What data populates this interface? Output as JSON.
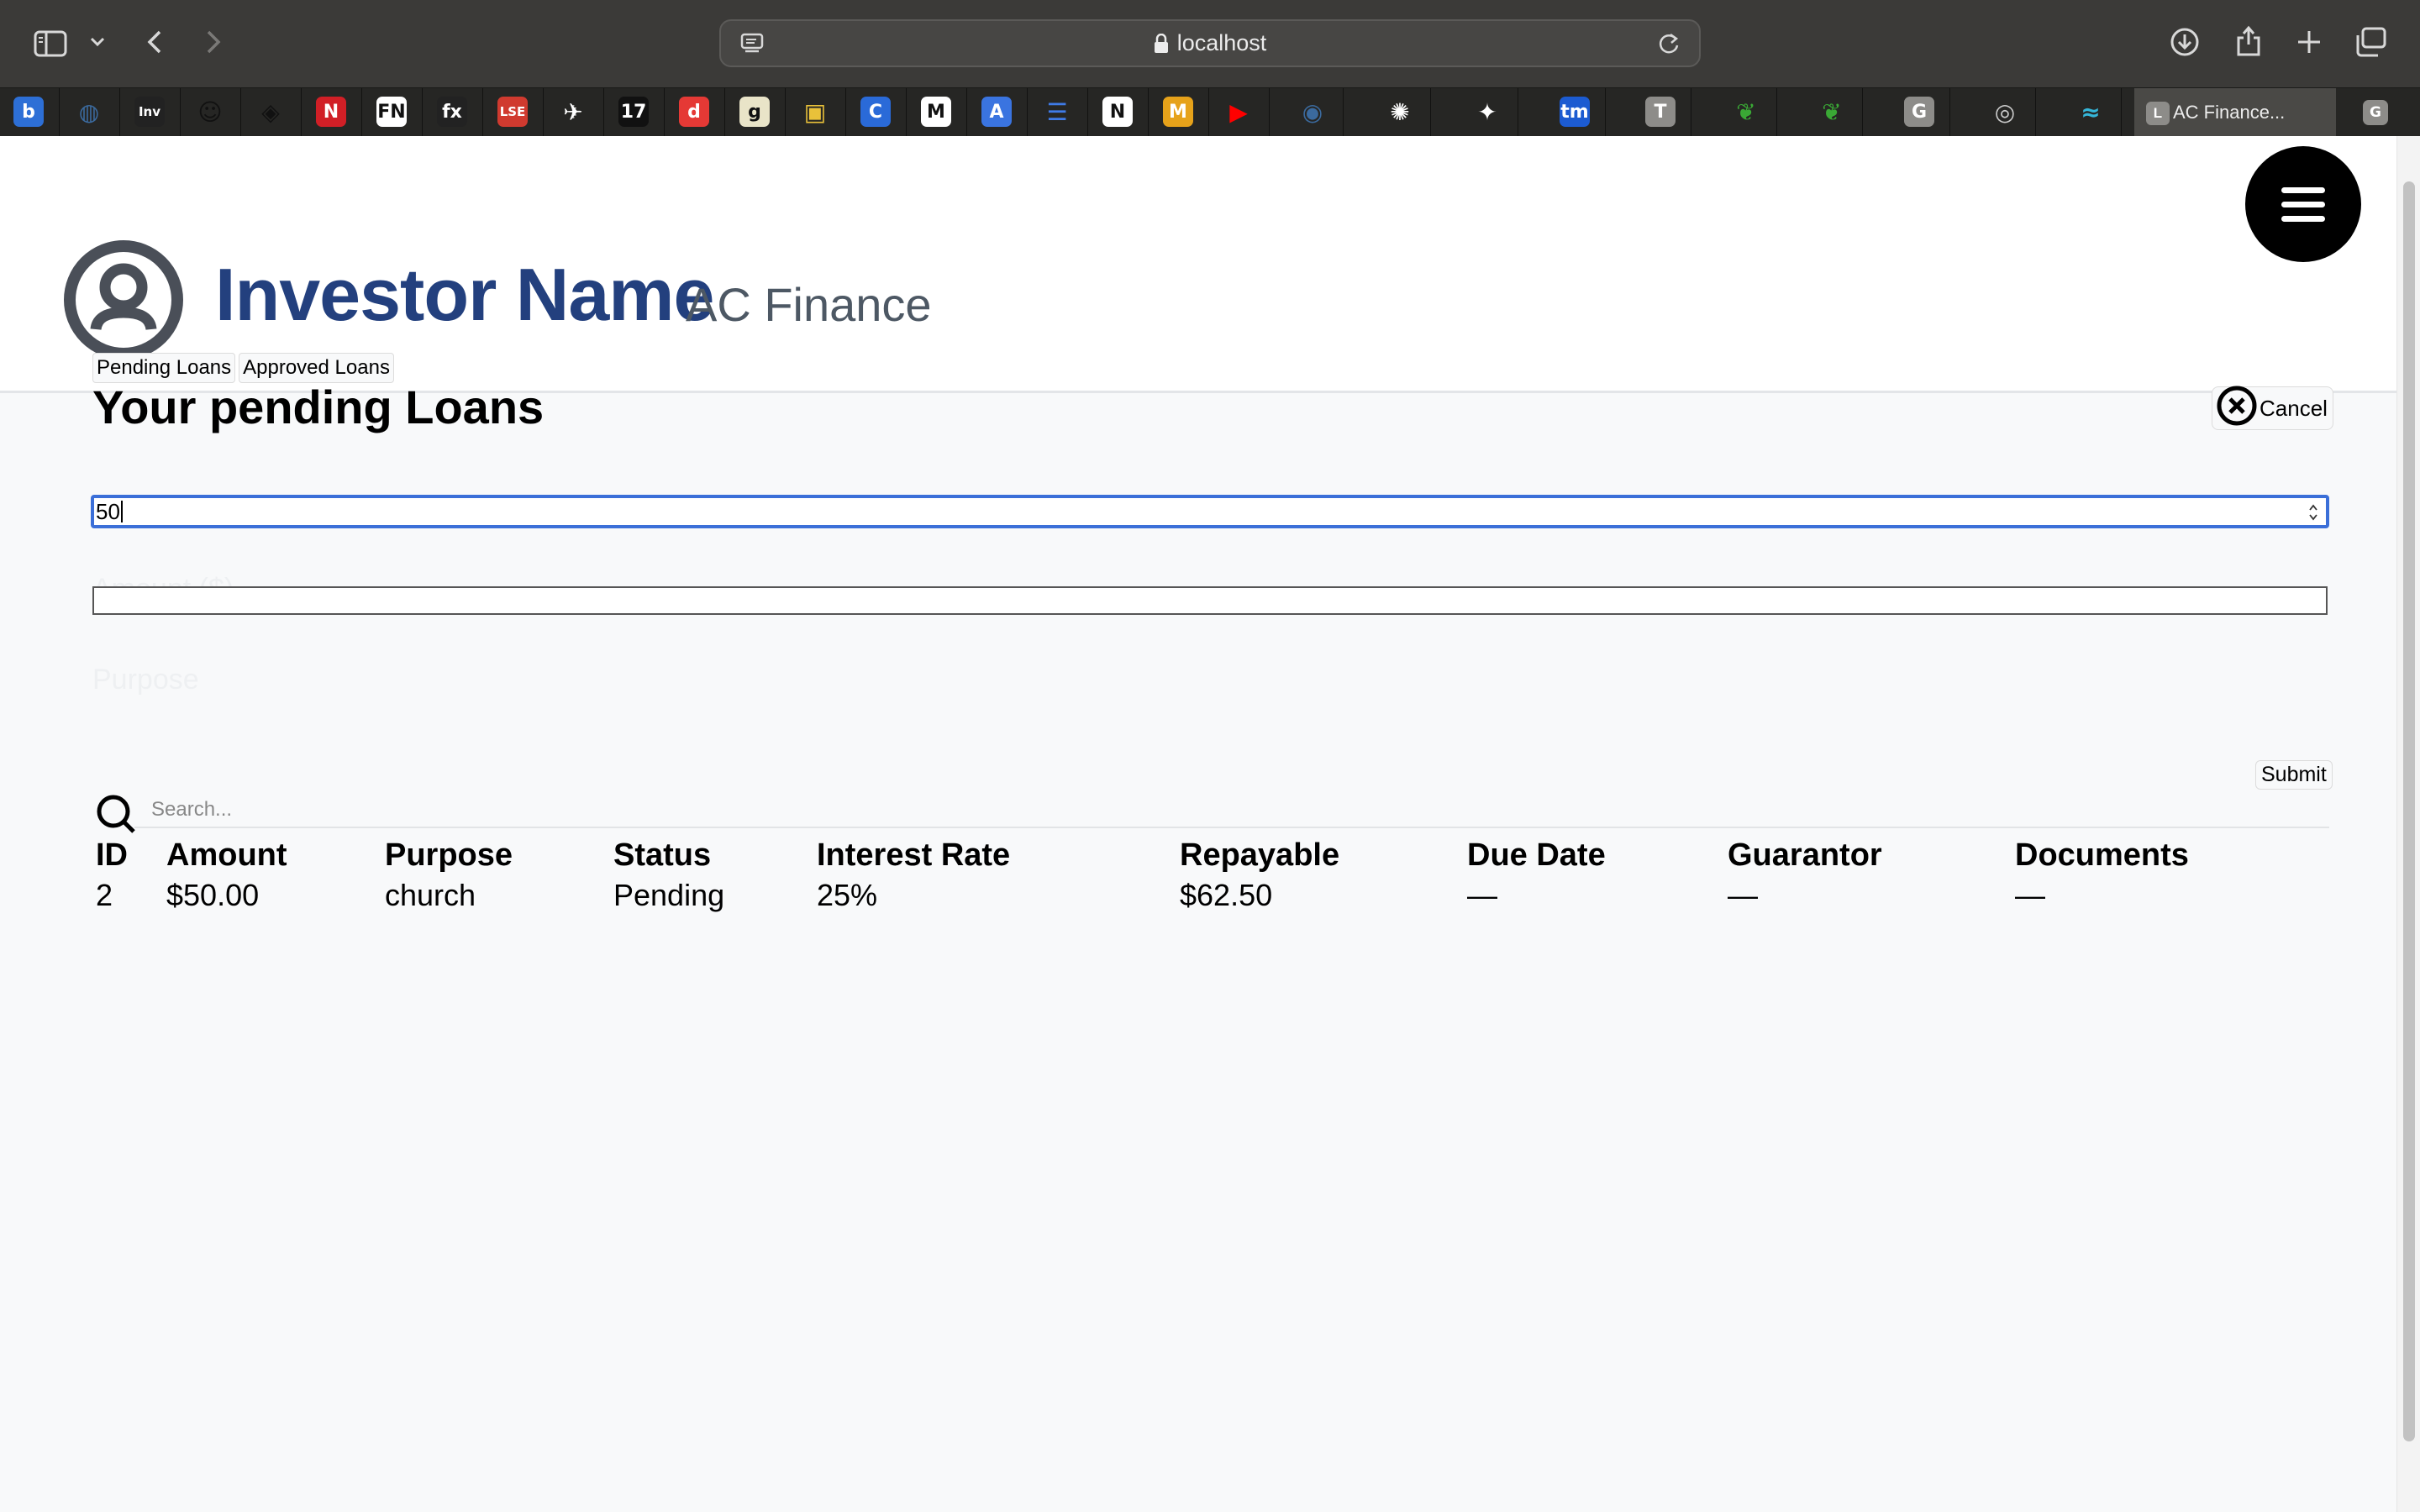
{
  "browser": {
    "url": "localhost",
    "active_tab_title": "AC Finance...",
    "active_tab_favicon_letter": "L",
    "last_tab_favicon_letter": "G",
    "bookmarks": [
      {
        "icon": "b",
        "color": "#2d6fd6"
      },
      {
        "icon": "globe-icon",
        "color": "#3b6a9e"
      },
      {
        "icon": "Inv",
        "color": "#222222"
      },
      {
        "icon": "bot-icon",
        "color": "#111111"
      },
      {
        "icon": "diamond-icon",
        "color": "#111111"
      },
      {
        "icon": "N",
        "color": "#d11f26"
      },
      {
        "icon": "FN",
        "color": "#ffffff"
      },
      {
        "icon": "fx",
        "color": "#222222"
      },
      {
        "icon": "LSE",
        "color": "#d03a2f"
      },
      {
        "icon": "bird-icon",
        "color": "#ffffff"
      },
      {
        "icon": "17",
        "color": "#111111"
      },
      {
        "icon": "d",
        "color": "#e53935"
      },
      {
        "icon": "g",
        "color": "#e9e4c8"
      },
      {
        "icon": "image-icon",
        "color": "#e9c13a"
      },
      {
        "icon": "C",
        "color": "#2a6ad8"
      },
      {
        "icon": "M",
        "color": "#ffffff"
      },
      {
        "icon": "A",
        "color": "#3a74e0"
      },
      {
        "icon": "docs-icon",
        "color": "#3f7be8"
      },
      {
        "icon": "N",
        "color": "#ffffff"
      },
      {
        "icon": "M",
        "color": "#e6a21a"
      },
      {
        "icon": "youtube-icon",
        "color": "#ff0000"
      },
      {
        "icon": "earth-icon",
        "color": "#3b6a9e"
      },
      {
        "icon": "openai-icon",
        "color": "#ffffff"
      },
      {
        "icon": "sparkle-icon",
        "color": "#ffffff"
      },
      {
        "icon": "tm",
        "color": "#1c5bd1"
      },
      {
        "icon": "T",
        "color": "#8d8c89"
      },
      {
        "icon": "evernote-icon",
        "color": "#3aa935"
      },
      {
        "icon": "evernote-icon",
        "color": "#3aa935"
      },
      {
        "icon": "G",
        "color": "#8d8c89"
      },
      {
        "icon": "compass-icon",
        "color": "#cccccc"
      },
      {
        "icon": "wave-icon",
        "color": "#35b6d9"
      }
    ]
  },
  "header": {
    "investor_name": "Investor Name",
    "brand": "AC Finance"
  },
  "main": {
    "tabs": [
      "Pending Loans",
      "Approved Loans"
    ],
    "title": "Your pending Loans",
    "cancel_label": "Cancel",
    "amount_label": "Amount ($)",
    "amount_value": "50",
    "purpose_label": "Purpose",
    "submit_label": "Submit",
    "search_placeholder": "Search..."
  },
  "table": {
    "columns": [
      "ID",
      "Amount",
      "Purpose",
      "Status",
      "Interest Rate",
      "Repayable",
      "Due Date",
      "Guarantor",
      "Documents"
    ],
    "rows": [
      [
        "2",
        "$50.00",
        "church",
        "Pending",
        "25%",
        "$62.50",
        "—",
        "—",
        "—"
      ]
    ]
  },
  "colors": {
    "brand_blue": "#23407e",
    "focus_blue": "#3b6fd8",
    "chrome_dark": "#3b3a38"
  }
}
